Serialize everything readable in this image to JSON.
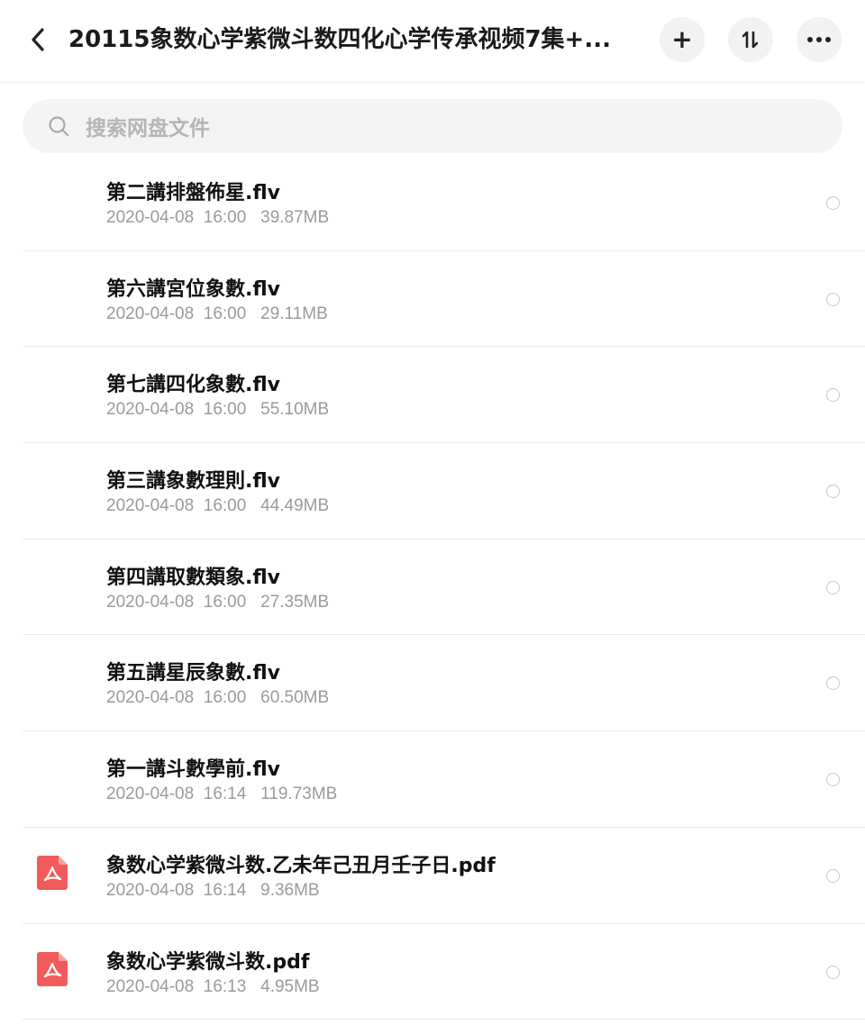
{
  "header": {
    "title": "20115象数心学紫微斗数四化心学传承视频7集+...",
    "back_icon": "chevron-left-icon",
    "add_icon": "plus-icon",
    "add_glyph": "+",
    "sort_icon": "sort-icon",
    "sort_glyph": "⇅",
    "more_icon": "more-icon",
    "more_glyph": "•••"
  },
  "search": {
    "placeholder": "搜索网盘文件",
    "icon": "search-icon"
  },
  "files": [
    {
      "name": "第二講排盤佈星.flv",
      "meta": "2020-04-08  16:00   39.87MB",
      "type": "video"
    },
    {
      "name": "第六講宮位象數.flv",
      "meta": "2020-04-08  16:00   29.11MB",
      "type": "video"
    },
    {
      "name": "第七講四化象數.flv",
      "meta": "2020-04-08  16:00   55.10MB",
      "type": "video"
    },
    {
      "name": "第三講象數理則.flv",
      "meta": "2020-04-08  16:00   44.49MB",
      "type": "video"
    },
    {
      "name": "第四講取數類象.flv",
      "meta": "2020-04-08  16:00   27.35MB",
      "type": "video"
    },
    {
      "name": "第五講星辰象數.flv",
      "meta": "2020-04-08  16:00   60.50MB",
      "type": "video"
    },
    {
      "name": "第一講斗數學前.flv",
      "meta": "2020-04-08  16:14   119.73MB",
      "type": "video"
    },
    {
      "name": "象数心学紫微斗数.乙未年己丑月壬子日.pdf",
      "meta": "2020-04-08  16:14   9.36MB",
      "type": "pdf"
    },
    {
      "name": "象数心学紫微斗数.pdf",
      "meta": "2020-04-08  16:13   4.95MB",
      "type": "pdf"
    }
  ],
  "colors": {
    "pdf_icon": "#f25b5b",
    "meta_text": "#9a9a9a",
    "button_bg": "#f2f2f2"
  }
}
